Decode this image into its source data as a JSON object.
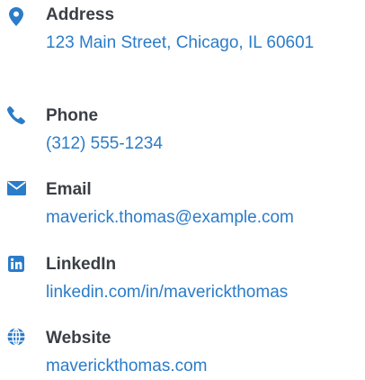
{
  "accent_color": "#2b7cc9",
  "label_color": "#3a3f45",
  "contacts": {
    "address": {
      "icon": "map-pin-icon",
      "label": "Address",
      "value": "123 Main Street, Chicago, IL 60601"
    },
    "phone": {
      "icon": "phone-icon",
      "label": "Phone",
      "value": "(312) 555-1234"
    },
    "email": {
      "icon": "envelope-icon",
      "label": "Email",
      "value": "maverick.thomas@example.com"
    },
    "linkedin": {
      "icon": "linkedin-icon",
      "label": "LinkedIn",
      "value": "linkedin.com/in/maverickthomas"
    },
    "website": {
      "icon": "globe-icon",
      "label": "Website",
      "value": "maverickthomas.com"
    }
  }
}
